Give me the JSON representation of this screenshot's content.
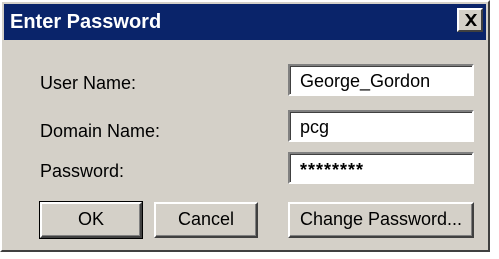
{
  "window": {
    "title": "Enter Password",
    "close_icon": "close-icon"
  },
  "form": {
    "user_name_label": "User Name:",
    "user_name_value": "George_Gordon",
    "domain_name_label": "Domain Name:",
    "domain_name_value": "pcg",
    "password_label": "Password:",
    "password_value": "********"
  },
  "buttons": {
    "ok_label": "OK",
    "cancel_label": "Cancel",
    "change_password_label": "Change Password..."
  },
  "colors": {
    "titlebar": "#0a246a",
    "face": "#d4d0c8"
  }
}
